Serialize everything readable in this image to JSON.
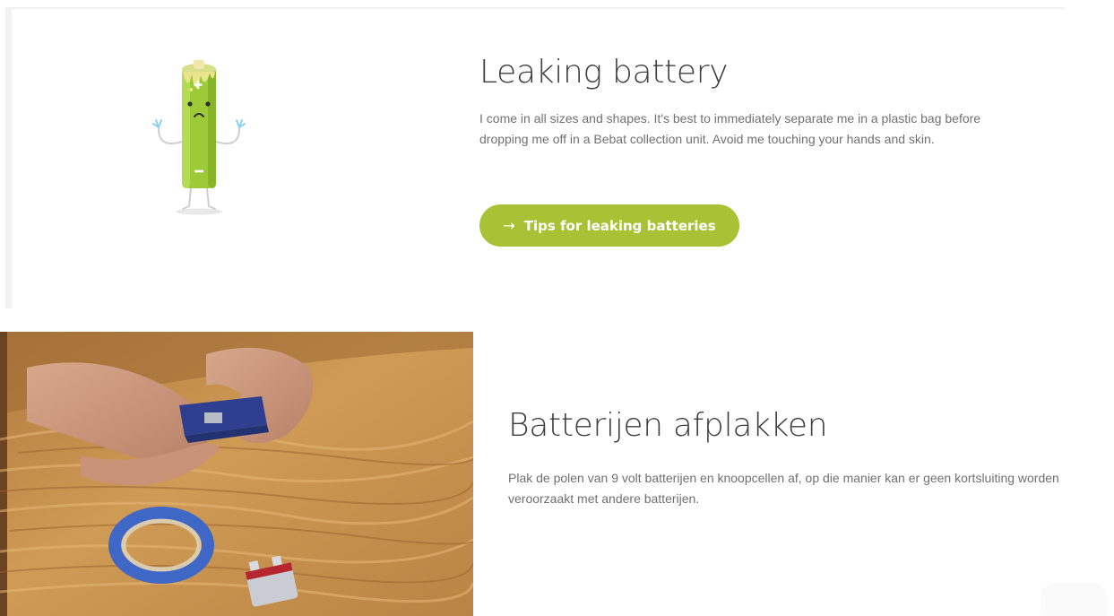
{
  "leaking_section": {
    "title": "Leaking battery",
    "description": "I come in all sizes and shapes. It's best to immediately separate me in a plastic bag before dropping me off in a Bebat collection unit. Avoid me touching your hands and skin.",
    "button_label": "Tips for leaking batteries",
    "button_icon": "arrow-right-icon",
    "accent_color": "#a9c235"
  },
  "taping_section": {
    "title": "Batterijen afplakken",
    "description": "Plak de polen van 9 volt batterijen en knoopcellen af, op die manier kan er geen kortsluiting worden veroorzaakt met andere batterijen."
  }
}
